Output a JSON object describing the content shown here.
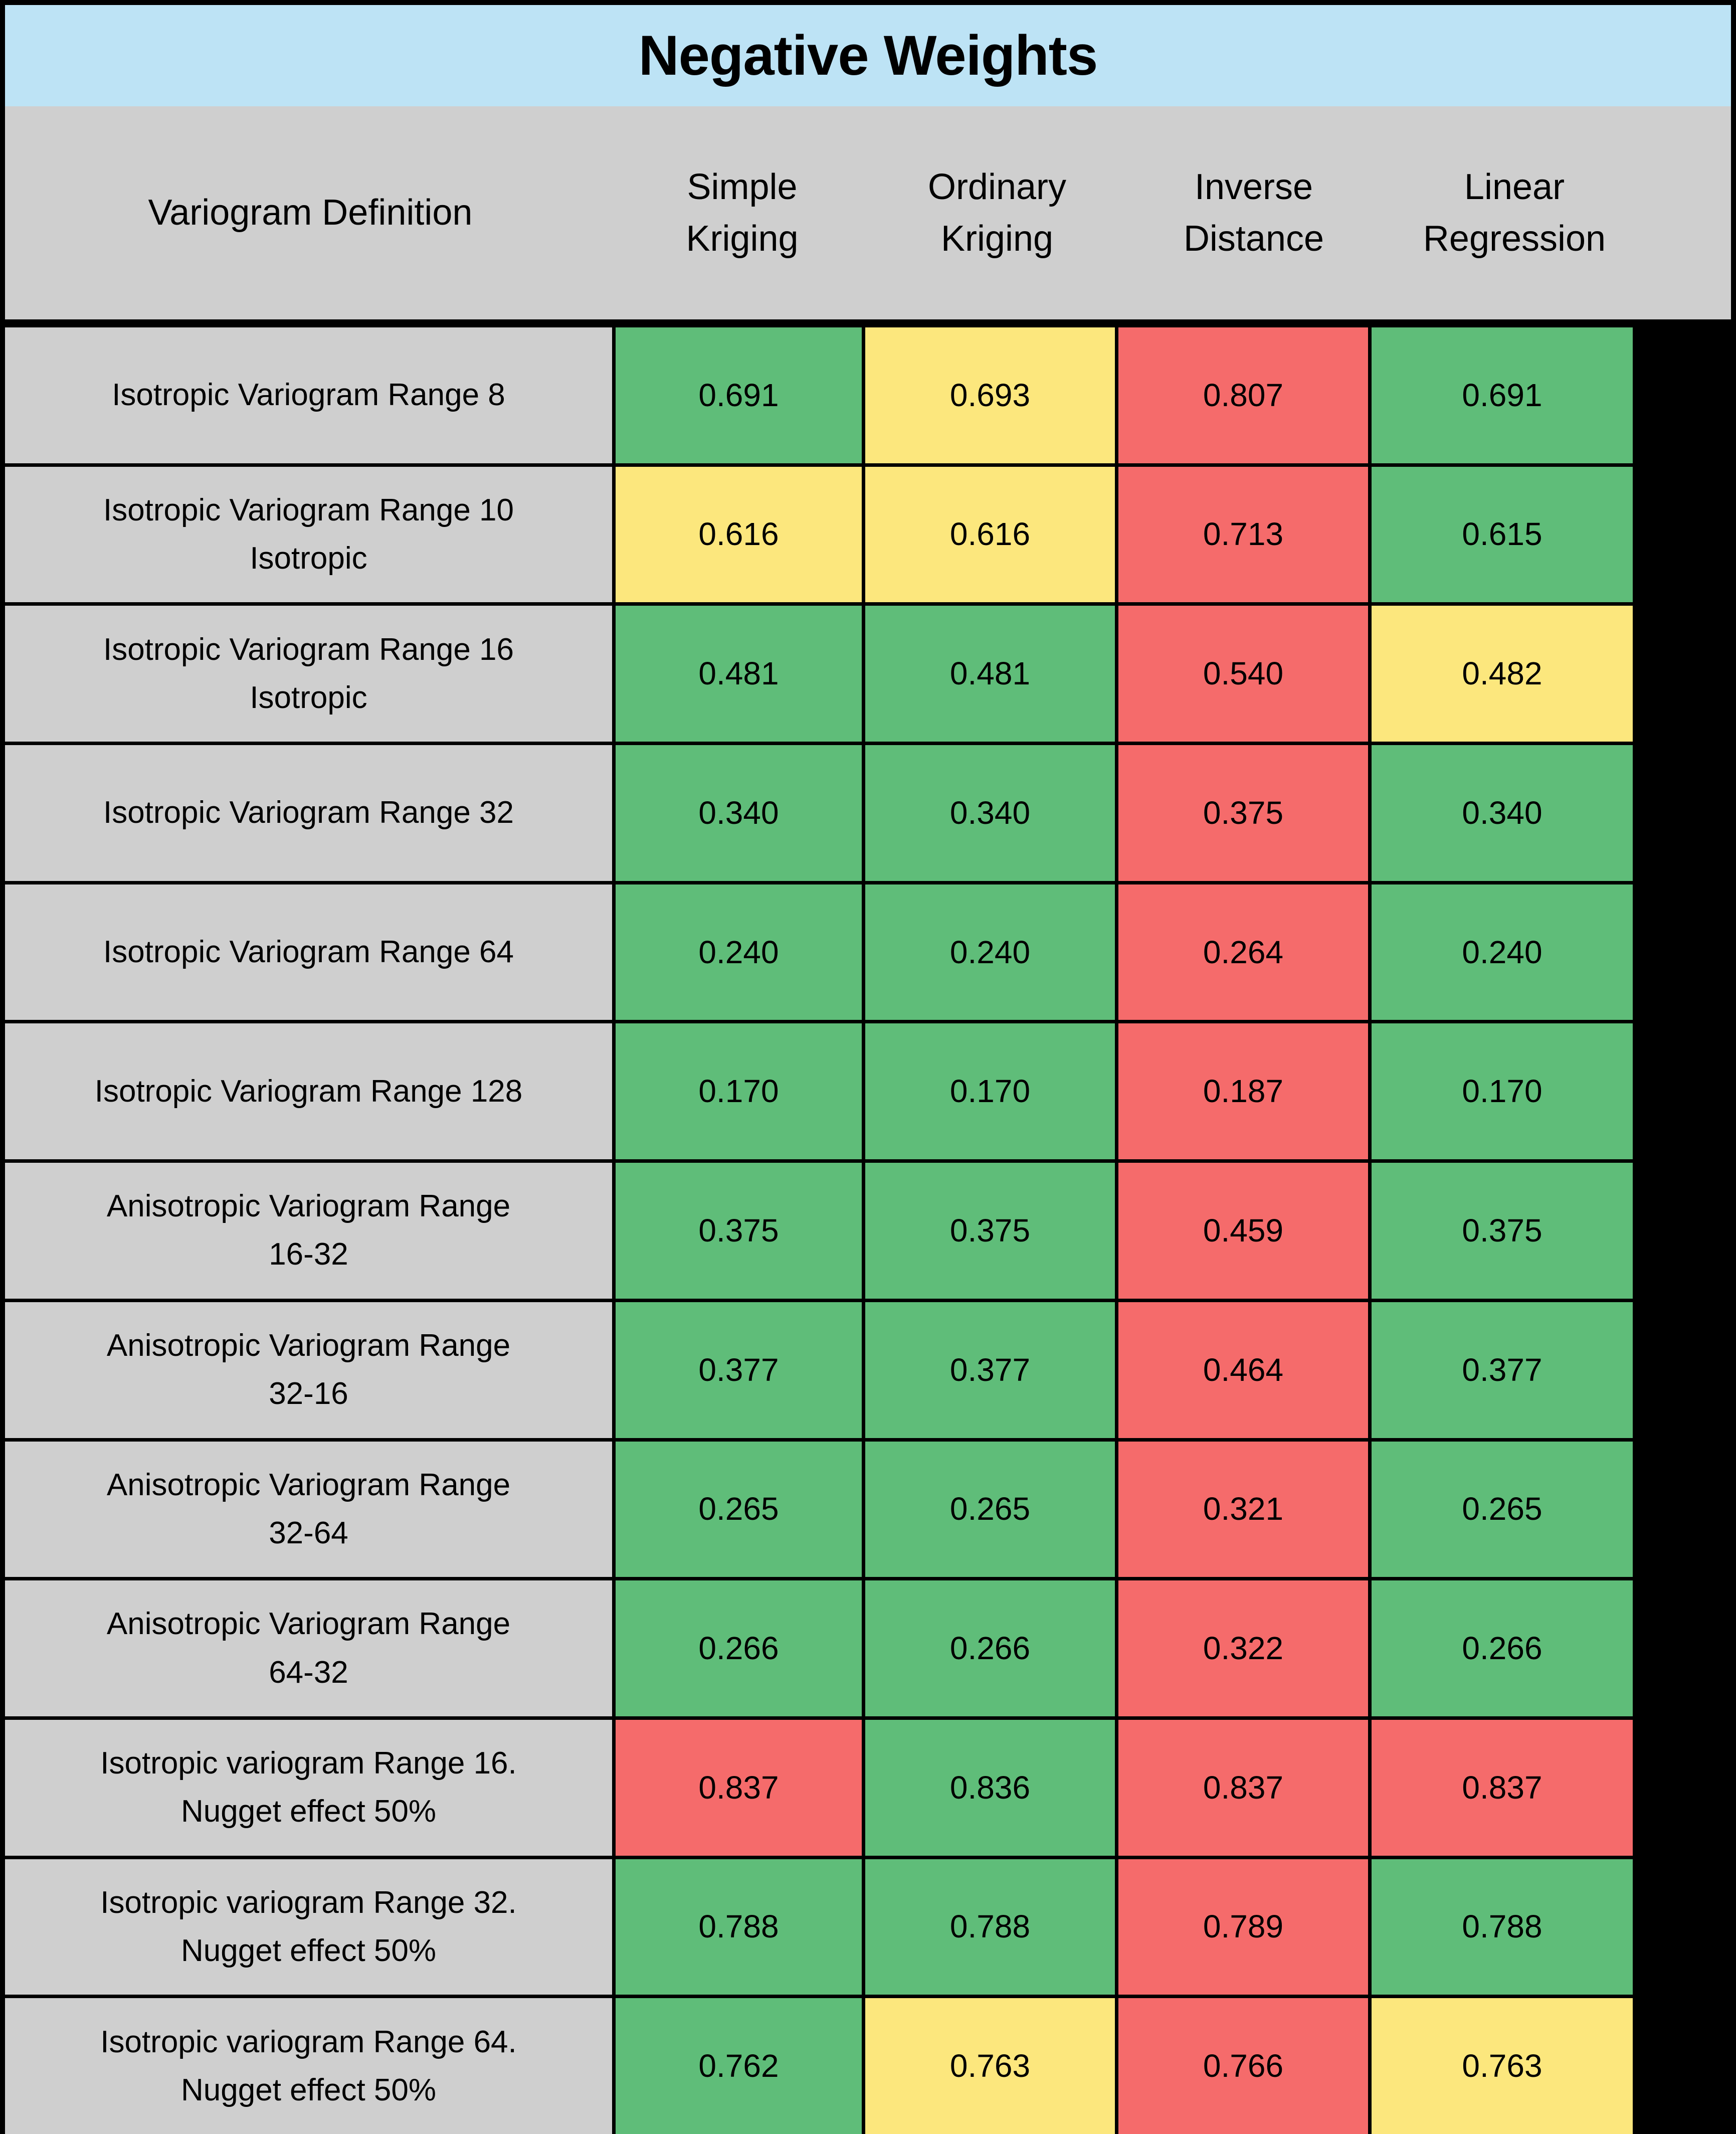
{
  "title": "Negative Weights",
  "colors": {
    "title_bar": "#BDE3F5",
    "header_bg": "#CFCFCF",
    "label_bg": "#CFCFCF",
    "green": "#5FBD79",
    "yellow": "#FCE77D",
    "red": "#F56B6B",
    "border": "#000000"
  },
  "header": {
    "col0": "Variogram Definition",
    "col1": "Simple\nKriging",
    "col1_line1": "Simple",
    "col1_line2": "Kriging",
    "col2_line1": "Ordinary",
    "col2_line2": "Kriging",
    "col3_line1": "Inverse",
    "col3_line2": "Distance",
    "col4_line1": "Linear",
    "col4_line2": "Regression"
  },
  "chart_data": {
    "type": "table",
    "title": "Negative Weights",
    "columns": [
      "Variogram Definition",
      "Simple Kriging",
      "Ordinary Kriging",
      "Inverse Distance",
      "Linear Regression"
    ],
    "rows": [
      {
        "label_line1": "Isotropic Variogram Range 8",
        "label_line2": "",
        "values": [
          "0.691",
          "0.693",
          "0.807",
          "0.691"
        ],
        "colors": [
          "green",
          "yellow",
          "red",
          "green"
        ]
      },
      {
        "label_line1": "Isotropic Variogram Range 10",
        "label_line2": "Isotropic",
        "values": [
          "0.616",
          "0.616",
          "0.713",
          "0.615"
        ],
        "colors": [
          "yellow",
          "yellow",
          "red",
          "green"
        ]
      },
      {
        "label_line1": "Isotropic Variogram Range 16",
        "label_line2": "Isotropic",
        "values": [
          "0.481",
          "0.481",
          "0.540",
          "0.482"
        ],
        "colors": [
          "green",
          "green",
          "red",
          "yellow"
        ]
      },
      {
        "label_line1": "Isotropic Variogram Range 32",
        "label_line2": "",
        "values": [
          "0.340",
          "0.340",
          "0.375",
          "0.340"
        ],
        "colors": [
          "green",
          "green",
          "red",
          "green"
        ]
      },
      {
        "label_line1": "Isotropic Variogram Range 64",
        "label_line2": "",
        "values": [
          "0.240",
          "0.240",
          "0.264",
          "0.240"
        ],
        "colors": [
          "green",
          "green",
          "red",
          "green"
        ]
      },
      {
        "label_line1": "Isotropic Variogram Range 128",
        "label_line2": "",
        "values": [
          "0.170",
          "0.170",
          "0.187",
          "0.170"
        ],
        "colors": [
          "green",
          "green",
          "red",
          "green"
        ]
      },
      {
        "label_line1": "Anisotropic Variogram Range",
        "label_line2": "16-32",
        "values": [
          "0.375",
          "0.375",
          "0.459",
          "0.375"
        ],
        "colors": [
          "green",
          "green",
          "red",
          "green"
        ]
      },
      {
        "label_line1": "Anisotropic Variogram Range",
        "label_line2": "32-16",
        "values": [
          "0.377",
          "0.377",
          "0.464",
          "0.377"
        ],
        "colors": [
          "green",
          "green",
          "red",
          "green"
        ]
      },
      {
        "label_line1": "Anisotropic Variogram Range",
        "label_line2": "32-64",
        "values": [
          "0.265",
          "0.265",
          "0.321",
          "0.265"
        ],
        "colors": [
          "green",
          "green",
          "red",
          "green"
        ]
      },
      {
        "label_line1": "Anisotropic Variogram Range",
        "label_line2": "64-32",
        "values": [
          "0.266",
          "0.266",
          "0.322",
          "0.266"
        ],
        "colors": [
          "green",
          "green",
          "red",
          "green"
        ]
      },
      {
        "label_line1": "Isotropic variogram Range 16.",
        "label_line2": "Nugget effect 50%",
        "values": [
          "0.837",
          "0.836",
          "0.837",
          "0.837"
        ],
        "colors": [
          "red",
          "green",
          "red",
          "red"
        ]
      },
      {
        "label_line1": "Isotropic variogram Range 32.",
        "label_line2": "Nugget effect 50%",
        "values": [
          "0.788",
          "0.788",
          "0.789",
          "0.788"
        ],
        "colors": [
          "green",
          "green",
          "red",
          "green"
        ]
      },
      {
        "label_line1": "Isotropic variogram Range 64.",
        "label_line2": "Nugget effect 50%",
        "values": [
          "0.762",
          "0.763",
          "0.766",
          "0.763"
        ],
        "colors": [
          "green",
          "yellow",
          "red",
          "yellow"
        ]
      }
    ]
  }
}
